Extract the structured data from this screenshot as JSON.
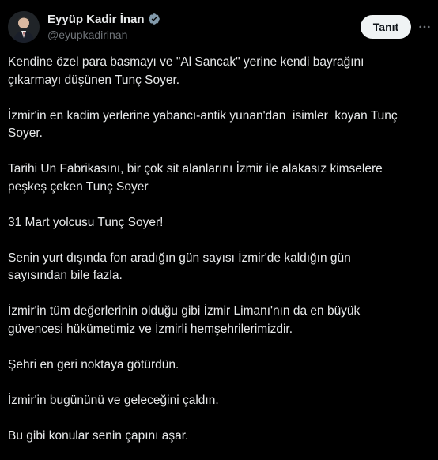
{
  "author": {
    "display_name": "Eyyüp Kadir İnan",
    "handle": "@eyupkadirinan",
    "verified": true,
    "avatar_icon": "profile-photo"
  },
  "actions": {
    "follow_label": "Tanıt",
    "more_icon": "ellipsis-icon"
  },
  "tweet": {
    "paragraphs": [
      "Kendine özel para basmayı ve \"Al Sancak\" yerine kendi bayrağını\nçıkarmayı düşünen Tunç Soyer.",
      "İzmir'in en kadim yerlerine yabancı-antik yunan'dan  isimler  koyan Tunç\nSoyer.",
      "Tarihi Un Fabrikasını, bir çok sit alanlarını İzmir ile alakasız kimselere\npeşkeş çeken Tunç Soyer",
      "31 Mart yolcusu Tunç Soyer!",
      "Senin yurt dışında fon aradığın gün sayısı İzmir'de kaldığın gün\nsayısından bile fazla.",
      "İzmir'in tüm değerlerinin olduğu gibi İzmir Limanı'nın da en büyük\ngüvencesi hükümetimiz ve İzmirli hemşehrilerimizdir.",
      "Şehri en geri noktaya götürdün.",
      "İzmir'in bugününü ve geleceğini çaldın.",
      "Bu gibi konular senin çapını aşar."
    ]
  },
  "colors": {
    "background": "#000000",
    "text_primary": "#e7e9ea",
    "text_secondary": "#71767b",
    "verified_badge": "#829aab",
    "button_bg": "#eff3f4"
  }
}
